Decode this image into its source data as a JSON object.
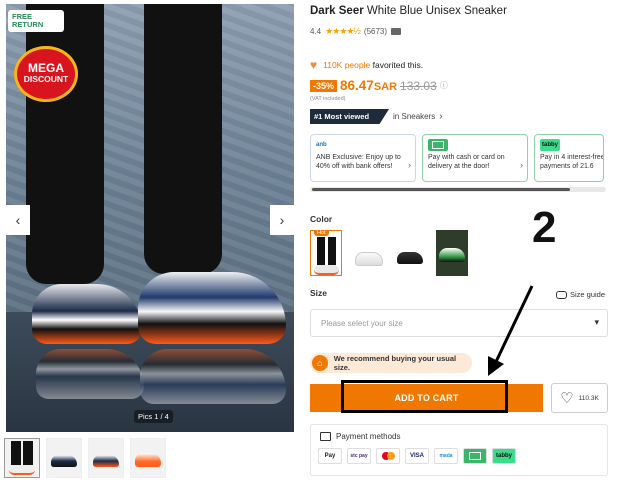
{
  "gallery": {
    "free_return": [
      "FREE",
      "RETURN"
    ],
    "badge": [
      "MEGA",
      "DISCOUNT"
    ],
    "prev_icon": "chevron-left-icon",
    "next_icon": "chevron-right-icon",
    "pics_counter": "Pics 1 / 4"
  },
  "product": {
    "brand": "Dark Seer",
    "name": "White Blue Unisex Sneaker",
    "rating": "4.4",
    "stars": "★★★★½",
    "reviews": "(5673)",
    "fav_count": "110K people",
    "fav_text": "favorited this.",
    "discount": "-35%",
    "price": "86.47",
    "currency": "SAR",
    "old_price": "133.03",
    "vat": "(VAT included)",
    "most_viewed": "#1 Most viewed",
    "most_viewed_in": "in Sneakers"
  },
  "promos": [
    {
      "logo": "anb",
      "text": "ANB Exclusive: Enjoy up to 40% off with bank offers!"
    },
    {
      "logo": "",
      "text": "Pay with cash or card on delivery at the door!"
    },
    {
      "logo": "tabby",
      "text": "Pay in 4 interest-free payments of 21.6"
    }
  ],
  "color": {
    "label": "Color",
    "hot": "Hot"
  },
  "size": {
    "label": "Size",
    "guide": "Size guide",
    "placeholder": "Please select your size"
  },
  "recommend": "We recommend buying your usual size.",
  "cart": {
    "label": "ADD TO CART",
    "wish_count": "110.3K"
  },
  "payment": {
    "label": "Payment methods",
    "methods": [
      "Pay",
      "stc pay",
      "mc",
      "VISA",
      "mada",
      "cash",
      "tabby"
    ]
  },
  "annotation": {
    "number": "2"
  },
  "colors": {
    "accent": "#f07800",
    "dark_badge": "#1d2b3a"
  }
}
